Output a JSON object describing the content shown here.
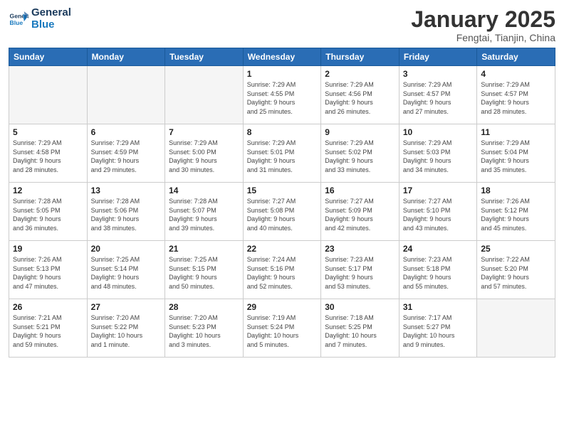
{
  "header": {
    "logo_line1": "General",
    "logo_line2": "Blue",
    "month": "January 2025",
    "location": "Fengtai, Tianjin, China"
  },
  "weekdays": [
    "Sunday",
    "Monday",
    "Tuesday",
    "Wednesday",
    "Thursday",
    "Friday",
    "Saturday"
  ],
  "weeks": [
    [
      {
        "day": "",
        "empty": true
      },
      {
        "day": "",
        "empty": true
      },
      {
        "day": "",
        "empty": true
      },
      {
        "day": "1",
        "info": "Sunrise: 7:29 AM\nSunset: 4:55 PM\nDaylight: 9 hours\nand 25 minutes."
      },
      {
        "day": "2",
        "info": "Sunrise: 7:29 AM\nSunset: 4:56 PM\nDaylight: 9 hours\nand 26 minutes."
      },
      {
        "day": "3",
        "info": "Sunrise: 7:29 AM\nSunset: 4:57 PM\nDaylight: 9 hours\nand 27 minutes."
      },
      {
        "day": "4",
        "info": "Sunrise: 7:29 AM\nSunset: 4:57 PM\nDaylight: 9 hours\nand 28 minutes."
      }
    ],
    [
      {
        "day": "5",
        "info": "Sunrise: 7:29 AM\nSunset: 4:58 PM\nDaylight: 9 hours\nand 28 minutes."
      },
      {
        "day": "6",
        "info": "Sunrise: 7:29 AM\nSunset: 4:59 PM\nDaylight: 9 hours\nand 29 minutes."
      },
      {
        "day": "7",
        "info": "Sunrise: 7:29 AM\nSunset: 5:00 PM\nDaylight: 9 hours\nand 30 minutes."
      },
      {
        "day": "8",
        "info": "Sunrise: 7:29 AM\nSunset: 5:01 PM\nDaylight: 9 hours\nand 31 minutes."
      },
      {
        "day": "9",
        "info": "Sunrise: 7:29 AM\nSunset: 5:02 PM\nDaylight: 9 hours\nand 33 minutes."
      },
      {
        "day": "10",
        "info": "Sunrise: 7:29 AM\nSunset: 5:03 PM\nDaylight: 9 hours\nand 34 minutes."
      },
      {
        "day": "11",
        "info": "Sunrise: 7:29 AM\nSunset: 5:04 PM\nDaylight: 9 hours\nand 35 minutes."
      }
    ],
    [
      {
        "day": "12",
        "info": "Sunrise: 7:28 AM\nSunset: 5:05 PM\nDaylight: 9 hours\nand 36 minutes."
      },
      {
        "day": "13",
        "info": "Sunrise: 7:28 AM\nSunset: 5:06 PM\nDaylight: 9 hours\nand 38 minutes."
      },
      {
        "day": "14",
        "info": "Sunrise: 7:28 AM\nSunset: 5:07 PM\nDaylight: 9 hours\nand 39 minutes."
      },
      {
        "day": "15",
        "info": "Sunrise: 7:27 AM\nSunset: 5:08 PM\nDaylight: 9 hours\nand 40 minutes."
      },
      {
        "day": "16",
        "info": "Sunrise: 7:27 AM\nSunset: 5:09 PM\nDaylight: 9 hours\nand 42 minutes."
      },
      {
        "day": "17",
        "info": "Sunrise: 7:27 AM\nSunset: 5:10 PM\nDaylight: 9 hours\nand 43 minutes."
      },
      {
        "day": "18",
        "info": "Sunrise: 7:26 AM\nSunset: 5:12 PM\nDaylight: 9 hours\nand 45 minutes."
      }
    ],
    [
      {
        "day": "19",
        "info": "Sunrise: 7:26 AM\nSunset: 5:13 PM\nDaylight: 9 hours\nand 47 minutes."
      },
      {
        "day": "20",
        "info": "Sunrise: 7:25 AM\nSunset: 5:14 PM\nDaylight: 9 hours\nand 48 minutes."
      },
      {
        "day": "21",
        "info": "Sunrise: 7:25 AM\nSunset: 5:15 PM\nDaylight: 9 hours\nand 50 minutes."
      },
      {
        "day": "22",
        "info": "Sunrise: 7:24 AM\nSunset: 5:16 PM\nDaylight: 9 hours\nand 52 minutes."
      },
      {
        "day": "23",
        "info": "Sunrise: 7:23 AM\nSunset: 5:17 PM\nDaylight: 9 hours\nand 53 minutes."
      },
      {
        "day": "24",
        "info": "Sunrise: 7:23 AM\nSunset: 5:18 PM\nDaylight: 9 hours\nand 55 minutes."
      },
      {
        "day": "25",
        "info": "Sunrise: 7:22 AM\nSunset: 5:20 PM\nDaylight: 9 hours\nand 57 minutes."
      }
    ],
    [
      {
        "day": "26",
        "info": "Sunrise: 7:21 AM\nSunset: 5:21 PM\nDaylight: 9 hours\nand 59 minutes."
      },
      {
        "day": "27",
        "info": "Sunrise: 7:20 AM\nSunset: 5:22 PM\nDaylight: 10 hours\nand 1 minute."
      },
      {
        "day": "28",
        "info": "Sunrise: 7:20 AM\nSunset: 5:23 PM\nDaylight: 10 hours\nand 3 minutes."
      },
      {
        "day": "29",
        "info": "Sunrise: 7:19 AM\nSunset: 5:24 PM\nDaylight: 10 hours\nand 5 minutes."
      },
      {
        "day": "30",
        "info": "Sunrise: 7:18 AM\nSunset: 5:25 PM\nDaylight: 10 hours\nand 7 minutes."
      },
      {
        "day": "31",
        "info": "Sunrise: 7:17 AM\nSunset: 5:27 PM\nDaylight: 10 hours\nand 9 minutes."
      },
      {
        "day": "",
        "empty": true
      }
    ]
  ]
}
